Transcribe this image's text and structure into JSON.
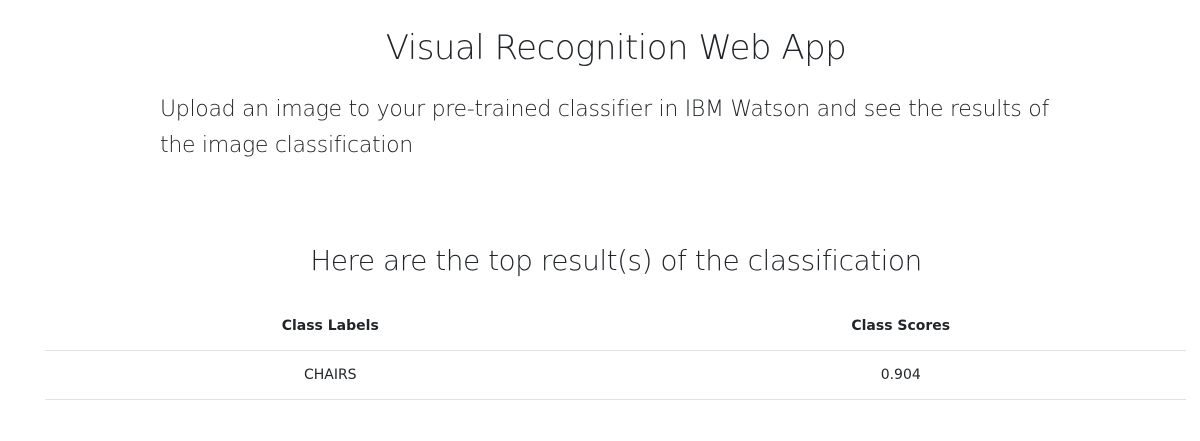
{
  "header": {
    "title": "Visual Recognition Web App",
    "description": "Upload an image to your pre-trained classifier in IBM Watson and see the results of the image classification"
  },
  "results": {
    "heading": "Here are the top result(s) of the classification",
    "columns": [
      "Class Labels",
      "Class Scores"
    ],
    "rows": [
      {
        "label": "CHAIRS",
        "score": "0.904"
      }
    ]
  }
}
